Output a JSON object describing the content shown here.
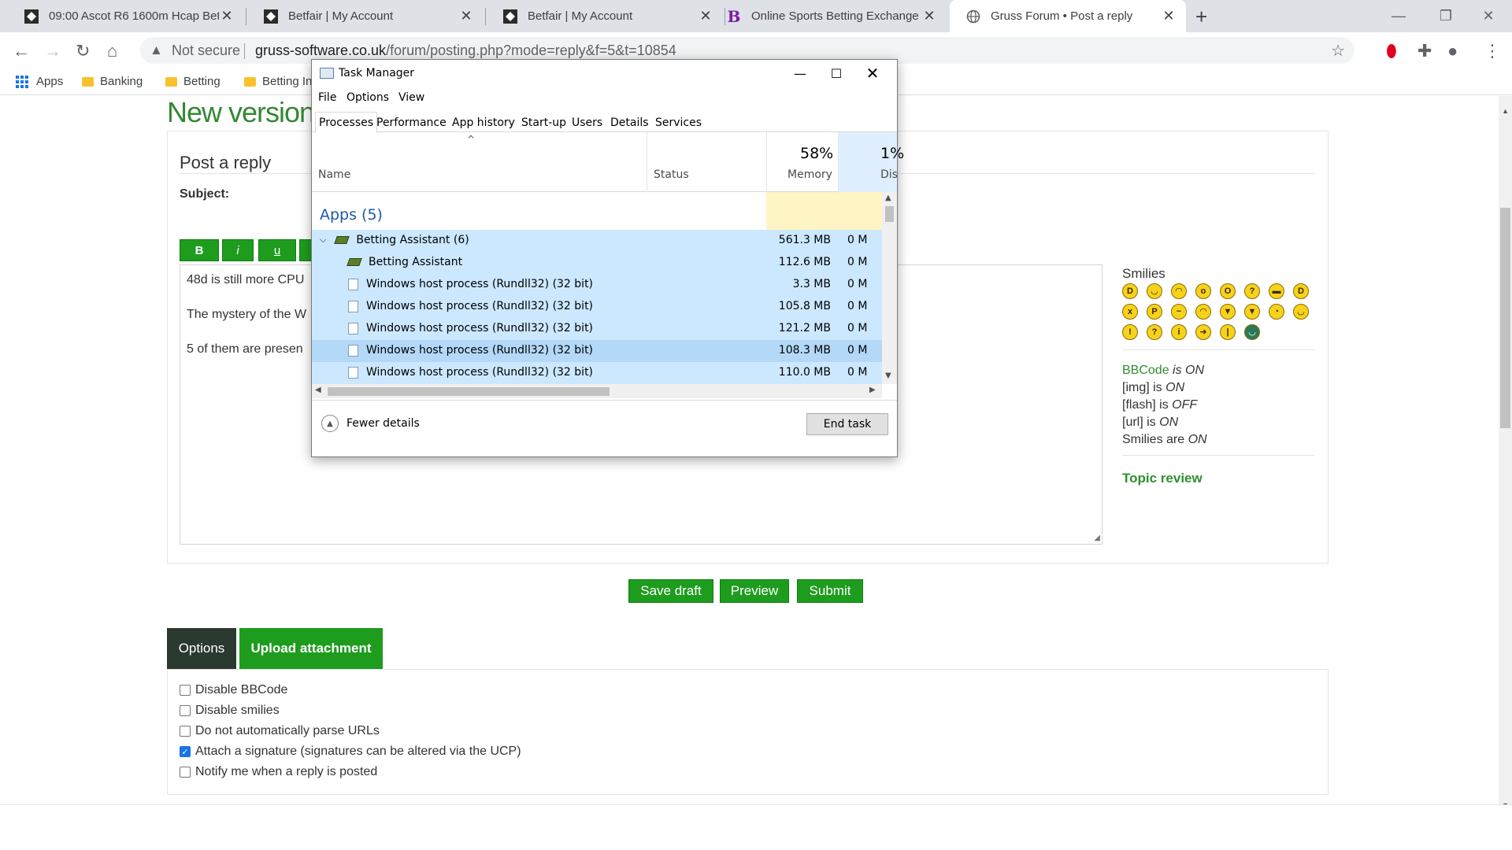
{
  "browser": {
    "tabs": [
      {
        "title": "09:00 Ascot R6 1600m Hcap Bett",
        "favicon": "betfair-icon"
      },
      {
        "title": "Betfair | My Account",
        "favicon": "betfair-icon"
      },
      {
        "title": "Betfair | My Account",
        "favicon": "betfair-icon"
      },
      {
        "title": "Online Sports Betting Exchange",
        "favicon": "b-icon"
      },
      {
        "title": "Gruss Forum • Post a reply",
        "favicon": "globe-icon"
      }
    ],
    "security_label": "Not secure",
    "url_host": "gruss-software.co.uk",
    "url_path": "/forum/posting.php?mode=reply&f=5&t=10854",
    "bookmarks": [
      "Apps",
      "Banking",
      "Betting",
      "Betting In"
    ]
  },
  "forum": {
    "heading": "New version",
    "post_reply_title": "Post a reply",
    "subject_label": "Subject:",
    "format_buttons": [
      "B",
      "i",
      "u"
    ],
    "message_lines": [
      "48d is still more CPU",
      "The mystery of the W",
      "5 of them are presen"
    ],
    "smilies_title": "Smilies",
    "smilies": [
      ":D",
      ":)",
      ":(",
      ":o",
      "8O",
      ":?",
      "8)",
      ":lol:",
      ":x",
      ":P",
      ":oops:",
      ":cry:",
      ":evil:",
      ":twisted:",
      ":roll:",
      ";)",
      ":!:",
      ":?:",
      ":idea:",
      ":arrow:",
      ":|",
      ":mrgreen:"
    ],
    "bbcode_info": {
      "bbcode_link": "BBCode",
      "bbcode_status": "is ON",
      "img": "[img] is",
      "img_status": "ON",
      "flash": "[flash] is",
      "flash_status": "OFF",
      "url": "[url] is",
      "url_status": "ON",
      "smilies": "Smilies are",
      "smilies_status": "ON"
    },
    "topic_review": "Topic review",
    "actions": {
      "save_draft": "Save draft",
      "preview": "Preview",
      "submit": "Submit"
    },
    "option_tabs": {
      "options": "Options",
      "upload": "Upload attachment"
    },
    "checkboxes": [
      {
        "label": "Disable BBCode",
        "checked": false
      },
      {
        "label": "Disable smilies",
        "checked": false
      },
      {
        "label": "Do not automatically parse URLs",
        "checked": false
      },
      {
        "label": "Attach a signature (signatures can be altered via the UCP)",
        "checked": true
      },
      {
        "label": "Notify me when a reply is posted",
        "checked": false
      }
    ]
  },
  "task_manager": {
    "title": "Task Manager",
    "menu": [
      "File",
      "Options",
      "View"
    ],
    "tabs": [
      "Processes",
      "Performance",
      "App history",
      "Start-up",
      "Users",
      "Details",
      "Services"
    ],
    "active_tab": "Processes",
    "columns": {
      "name": "Name",
      "status": "Status",
      "memory_pct": "58%",
      "memory": "Memory",
      "disk_pct": "1%",
      "disk": "Dis"
    },
    "group_label": "Apps (5)",
    "rows": [
      {
        "name": "Betting Assistant (6)",
        "memory": "561.3 MB",
        "disk": "0 M",
        "kind": "parent"
      },
      {
        "name": "Betting Assistant",
        "memory": "112.6 MB",
        "disk": "0 M",
        "kind": "app"
      },
      {
        "name": "Windows host process (Rundll32) (32 bit)",
        "memory": "3.3 MB",
        "disk": "0 M",
        "kind": "proc"
      },
      {
        "name": "Windows host process (Rundll32) (32 bit)",
        "memory": "105.8 MB",
        "disk": "0 M",
        "kind": "proc"
      },
      {
        "name": "Windows host process (Rundll32) (32 bit)",
        "memory": "121.2 MB",
        "disk": "0 M",
        "kind": "proc"
      },
      {
        "name": "Windows host process (Rundll32) (32 bit)",
        "memory": "108.3 MB",
        "disk": "0 M",
        "kind": "proc"
      },
      {
        "name": "Windows host process (Rundll32) (32 bit)",
        "memory": "110.0 MB",
        "disk": "0 M",
        "kind": "proc"
      }
    ],
    "fewer_details": "Fewer details",
    "end_task": "End task"
  }
}
